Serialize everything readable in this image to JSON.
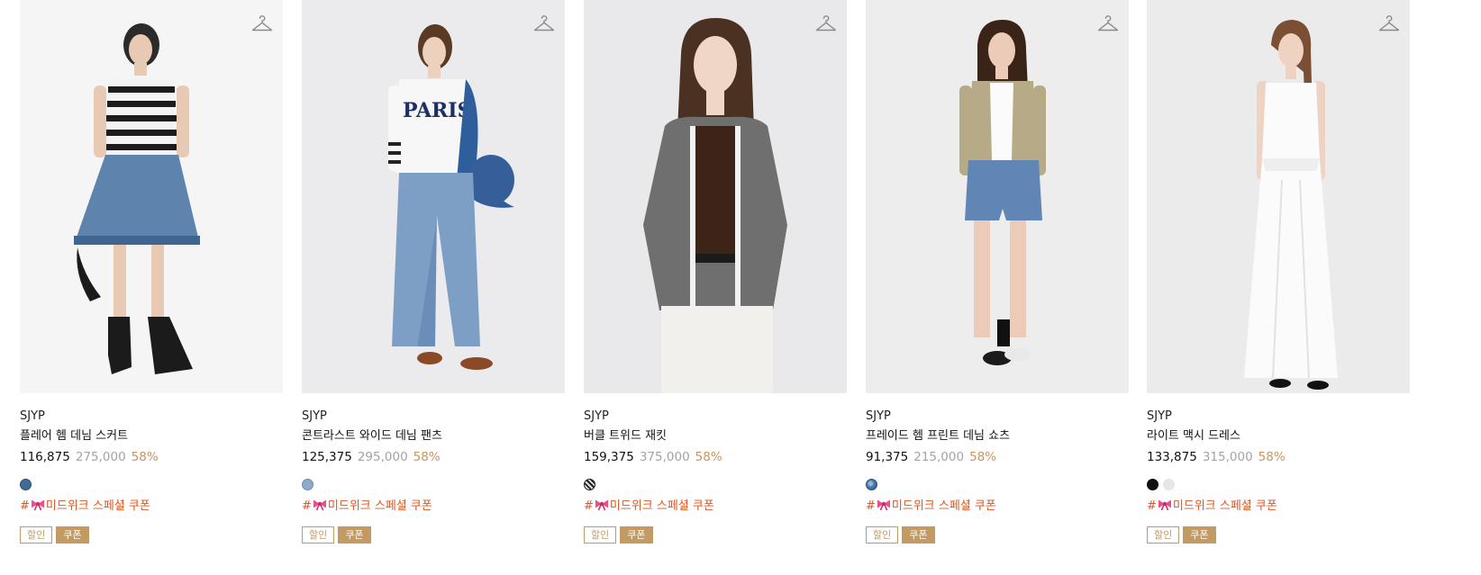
{
  "products": [
    {
      "brand": "SJYP",
      "name": "플레어 헴 데님 스커트",
      "sale_price": "116,875",
      "original_price": "275,000",
      "discount": "58%",
      "swatches": [
        "#3f6b98"
      ],
      "promo_hash": "#",
      "promo_text": "미드위크 스페셜 쿠폰",
      "tag_discount": "할인",
      "tag_coupon": "쿠폰"
    },
    {
      "brand": "SJYP",
      "name": "콘트라스트 와이드 데님 팬츠",
      "sale_price": "125,375",
      "original_price": "295,000",
      "discount": "58%",
      "swatches": [
        "#8fa9c7"
      ],
      "promo_hash": "#",
      "promo_text": "미드위크 스페셜 쿠폰",
      "tag_discount": "할인",
      "tag_coupon": "쿠폰"
    },
    {
      "brand": "SJYP",
      "name": "버클 트위드 재킷",
      "sale_price": "159,375",
      "original_price": "375,000",
      "discount": "58%",
      "swatches": [
        "#3b3b3b"
      ],
      "promo_hash": "#",
      "promo_text": "미드위크 스페셜 쿠폰",
      "tag_discount": "할인",
      "tag_coupon": "쿠폰"
    },
    {
      "brand": "SJYP",
      "name": "프레이드 헴 프린트 데님 쇼츠",
      "sale_price": "91,375",
      "original_price": "215,000",
      "discount": "58%",
      "swatches": [
        "#4d7baa"
      ],
      "promo_hash": "#",
      "promo_text": "미드위크 스페셜 쿠폰",
      "tag_discount": "할인",
      "tag_coupon": "쿠폰"
    },
    {
      "brand": "SJYP",
      "name": "라이트 맥시 드레스",
      "sale_price": "133,875",
      "original_price": "315,000",
      "discount": "58%",
      "swatches": [
        "#111111",
        "#e6e6e6"
      ],
      "promo_hash": "#",
      "promo_text": "미드위크 스페셜 쿠폰",
      "tag_discount": "할인",
      "tag_coupon": "쿠폰"
    }
  ],
  "icons": {
    "wishlist": "hanger-icon",
    "promo": "ribbon-bow-icon"
  },
  "colors": {
    "discount_rate": "#c8955e",
    "coupon_text": "#e0541f",
    "tag_gold": "#c49a63",
    "original_price": "#a3a3a3"
  }
}
